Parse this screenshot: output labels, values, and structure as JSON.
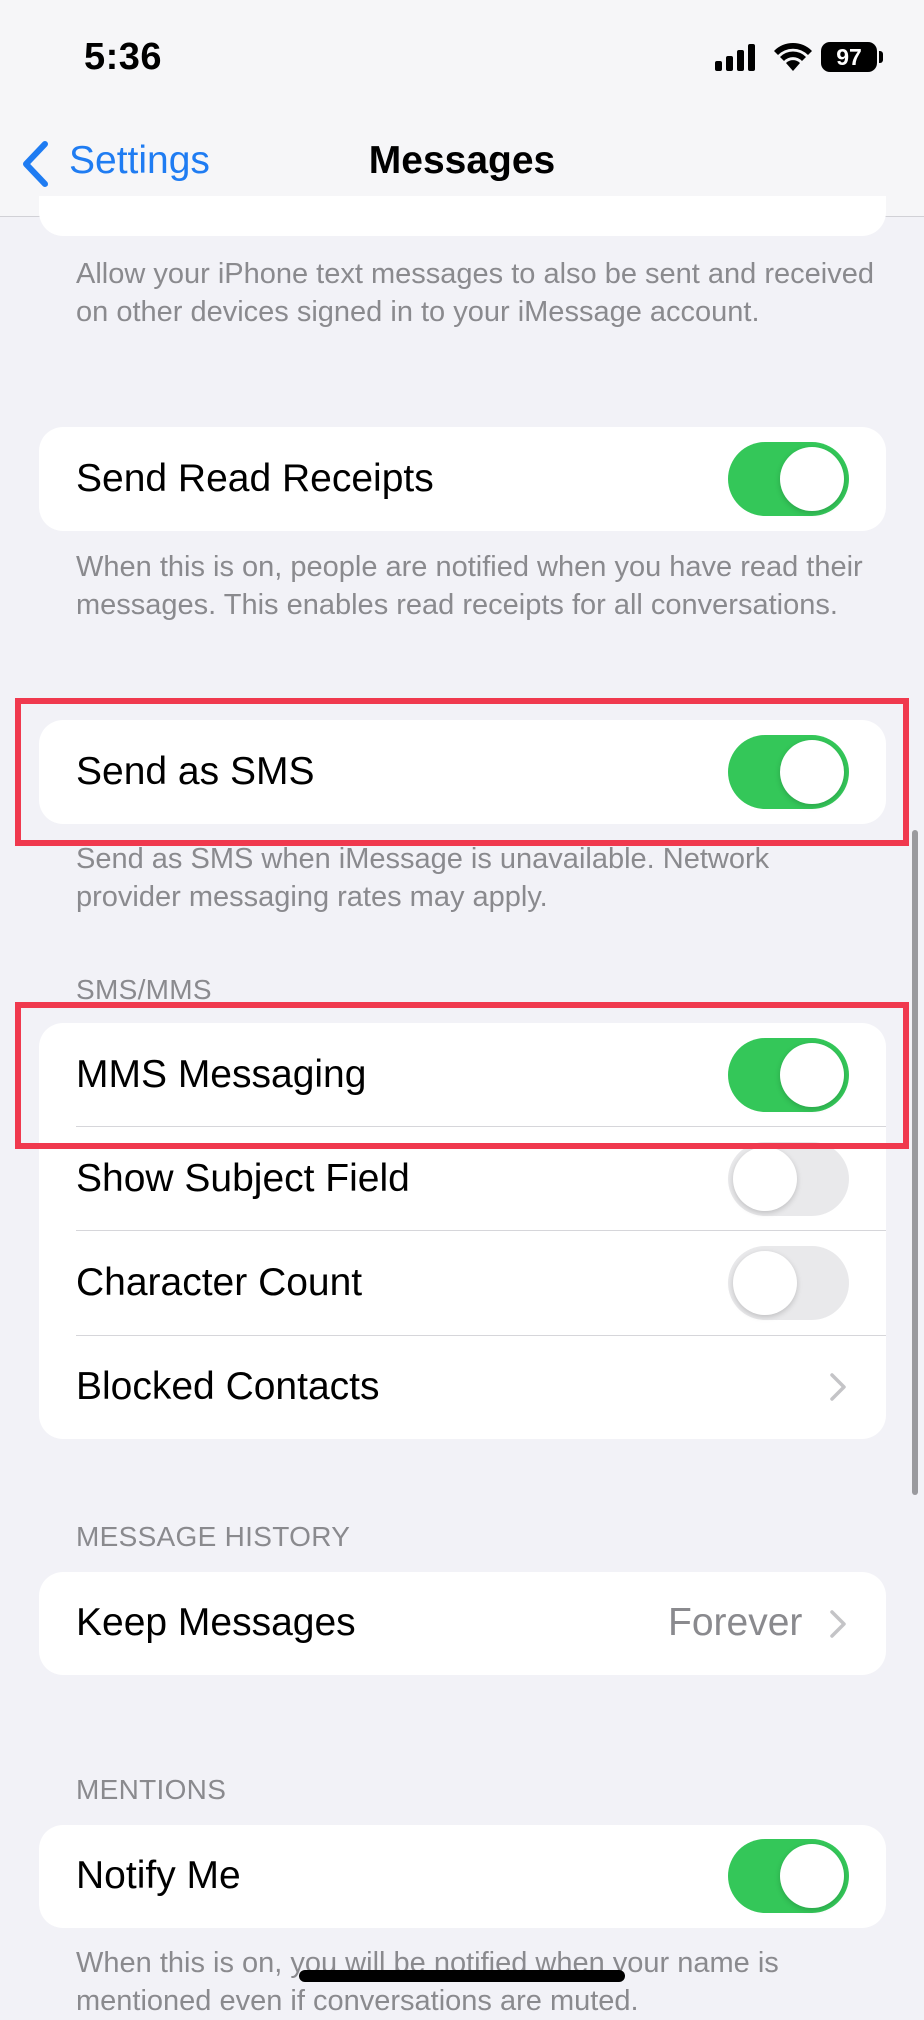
{
  "status_bar": {
    "time": "5:36",
    "battery": "97"
  },
  "nav": {
    "back_label": "Settings",
    "title": "Messages"
  },
  "sections": {
    "top_footer": "Allow your iPhone text messages to also be sent and received on other devices signed in to your iMessage account.",
    "read_receipts": {
      "label": "Send Read Receipts",
      "on": true,
      "footer": "When this is on, people are notified when you have read their messages. This enables read receipts for all conversations."
    },
    "send_as_sms": {
      "label": "Send as SMS",
      "on": true,
      "footer": "Send as SMS when iMessage is unavailable. Network provider messaging rates may apply."
    },
    "sms_mms": {
      "header": "SMS/MMS",
      "mms_messaging": {
        "label": "MMS Messaging",
        "on": true
      },
      "show_subject_field": {
        "label": "Show Subject Field",
        "on": false
      },
      "character_count": {
        "label": "Character Count",
        "on": false
      },
      "blocked_contacts": {
        "label": "Blocked Contacts"
      }
    },
    "message_history": {
      "header": "MESSAGE HISTORY",
      "keep_messages": {
        "label": "Keep Messages",
        "value": "Forever"
      }
    },
    "mentions": {
      "header": "MENTIONS",
      "notify_me": {
        "label": "Notify Me",
        "on": true
      },
      "footer": "When this is on, you will be notified when your name is mentioned even if conversations are muted."
    }
  },
  "colors": {
    "accent": "#1f7cf2",
    "toggle_on": "#34c759",
    "highlight": "#f0394e",
    "background": "#f2f2f7"
  }
}
